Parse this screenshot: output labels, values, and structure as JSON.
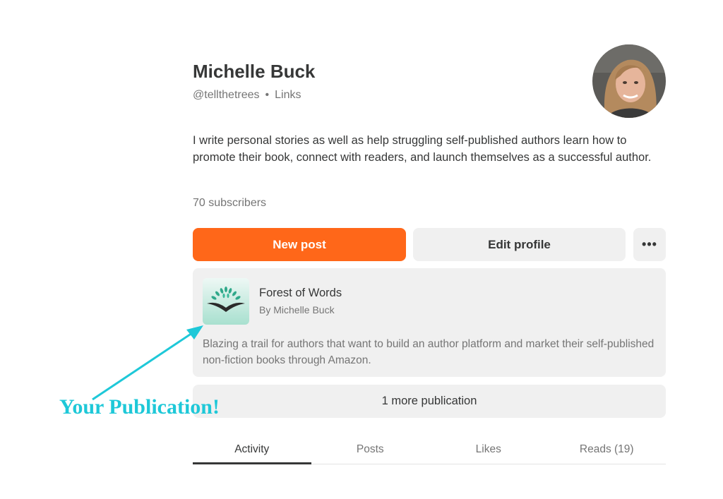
{
  "profile": {
    "name": "Michelle Buck",
    "handle": "@tellthetrees",
    "separator": "•",
    "links_label": "Links",
    "bio": "I write personal stories as well as help struggling self-published authors learn how to promote their book, connect with readers, and launch themselves as a successful author.",
    "subscribers": "70 subscribers",
    "avatar_icon": "user-photo"
  },
  "actions": {
    "new_post": "New post",
    "edit_profile": "Edit profile",
    "more": "•••"
  },
  "publication": {
    "title": "Forest of Words",
    "author": "By Michelle Buck",
    "description": "Blazing a trail for authors that want to build an author platform and market their self-published non-fiction books through Amazon.",
    "logo_icon": "tree-book-logo"
  },
  "more_publications": "1 more publication",
  "annotation": {
    "text": "Your Publication!",
    "color": "#1ec8d8"
  },
  "tabs": [
    {
      "label": "Activity",
      "active": true
    },
    {
      "label": "Posts",
      "active": false
    },
    {
      "label": "Likes",
      "active": false
    },
    {
      "label": "Reads (19)",
      "active": false
    }
  ],
  "colors": {
    "accent": "#ff6719",
    "surface": "#f0f0f0",
    "text": "#363737",
    "muted": "#757575"
  }
}
